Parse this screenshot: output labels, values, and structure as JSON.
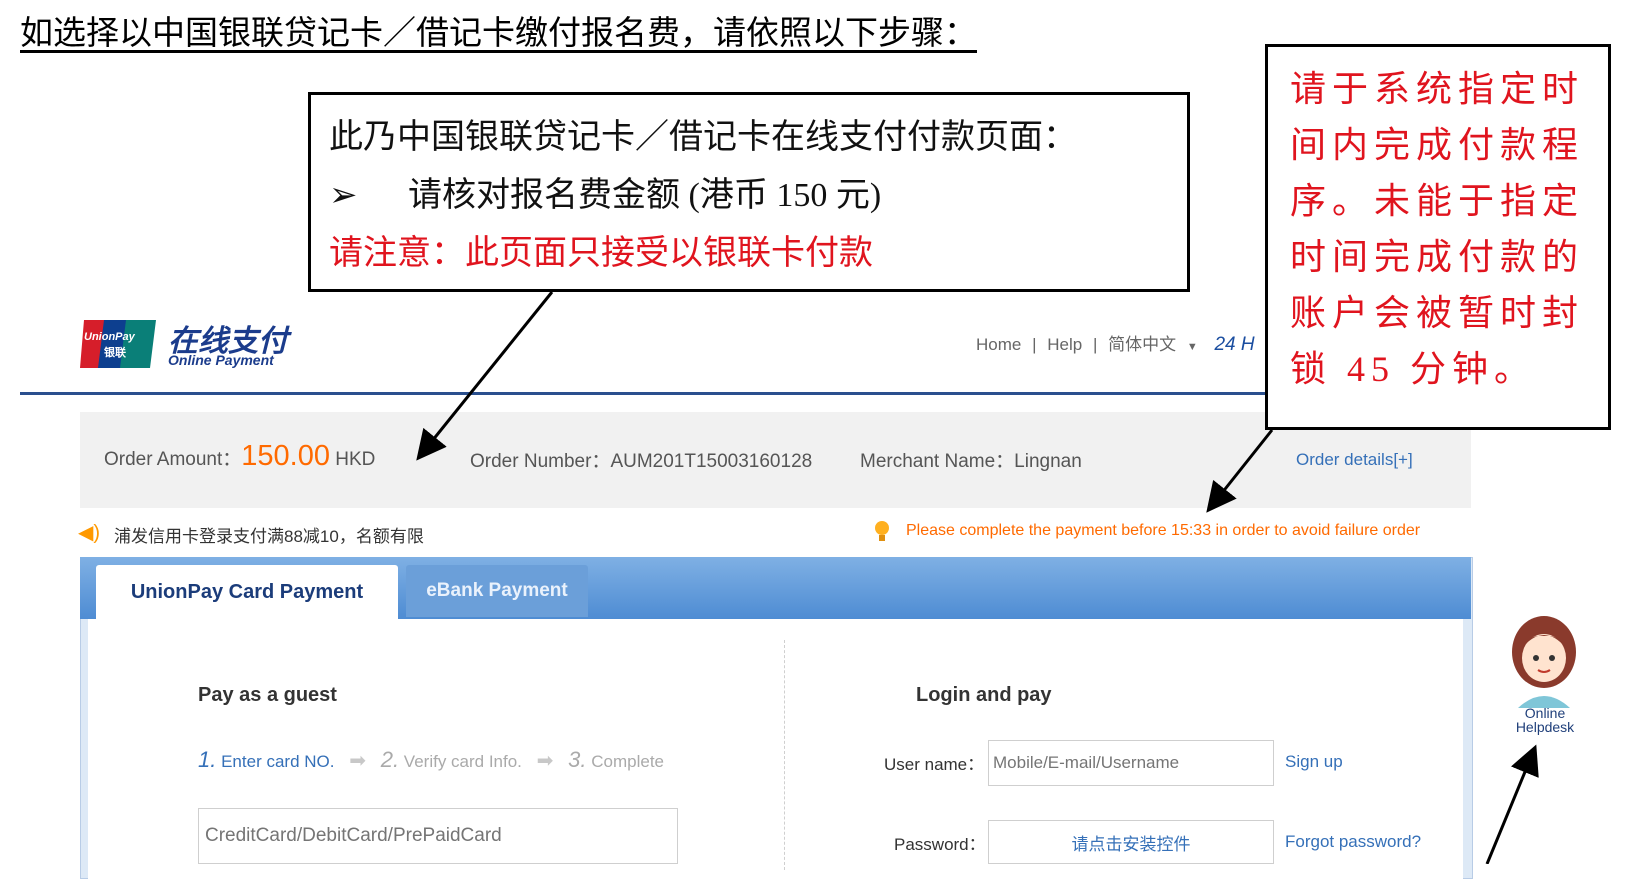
{
  "instruction": {
    "header": "如选择以中国银联贷记卡／借记卡缴付报名费，请依照以下步骤："
  },
  "callout_left": {
    "line1": "此乃中国银联贷记卡／借记卡在线支付付款页面：",
    "bullet": "➢",
    "line2": "请核对报名费金额 (港币 150 元)",
    "line3": "请注意：此页面只接受以银联卡付款"
  },
  "callout_right": {
    "text": "请于系统指定时间内完成付款程序。未能于指定时间完成付款的账户会被暂时封锁 45 分钟。"
  },
  "site_header": {
    "logo_line1": "UnionPay",
    "logo_line2": "银联",
    "brand_cn": "在线支付",
    "brand_en": "Online Payment",
    "nav_home": "Home",
    "nav_help": "Help",
    "nav_sep": "|",
    "nav_lang": "简体中文",
    "nav_partial": "24 H"
  },
  "order": {
    "amount_label": "Order Amount：",
    "amount_value": "150.00",
    "currency": "HKD",
    "number_label": "Order Number：",
    "number_value": "AUM201T15003160128",
    "merchant_label": "Merchant Name：",
    "merchant_value": "Lingnan",
    "details_link": "Order details[+]"
  },
  "notices": {
    "promo": "浦发信用卡登录支付满88减10，名额有限",
    "warning": "Please complete the payment before 15:33 in order to avoid failure order"
  },
  "tabs": {
    "active": "UnionPay Card Payment",
    "ebank": "eBank Payment"
  },
  "guest": {
    "title": "Pay as a guest",
    "step1_num": "1.",
    "step1": "Enter card NO.",
    "step2_num": "2.",
    "step2": "Verify card Info.",
    "step3_num": "3.",
    "step3": "Complete",
    "card_placeholder": "CreditCard/DebitCard/PrePaidCard"
  },
  "login": {
    "title": "Login and pay",
    "username_label": "User name：",
    "username_placeholder": "Mobile/E-mail/Username",
    "signup": "Sign up",
    "password_label": "Password：",
    "password_button": "请点击安装控件",
    "forgot": "Forgot password?"
  },
  "helpdesk": {
    "line1": "Online",
    "line2": "Helpdesk"
  },
  "colors": {
    "callout_red": "#e0141e",
    "amount_orange": "#ff6a00",
    "unionpay_blue": "#1b3c8c",
    "link_blue": "#3570b8"
  }
}
